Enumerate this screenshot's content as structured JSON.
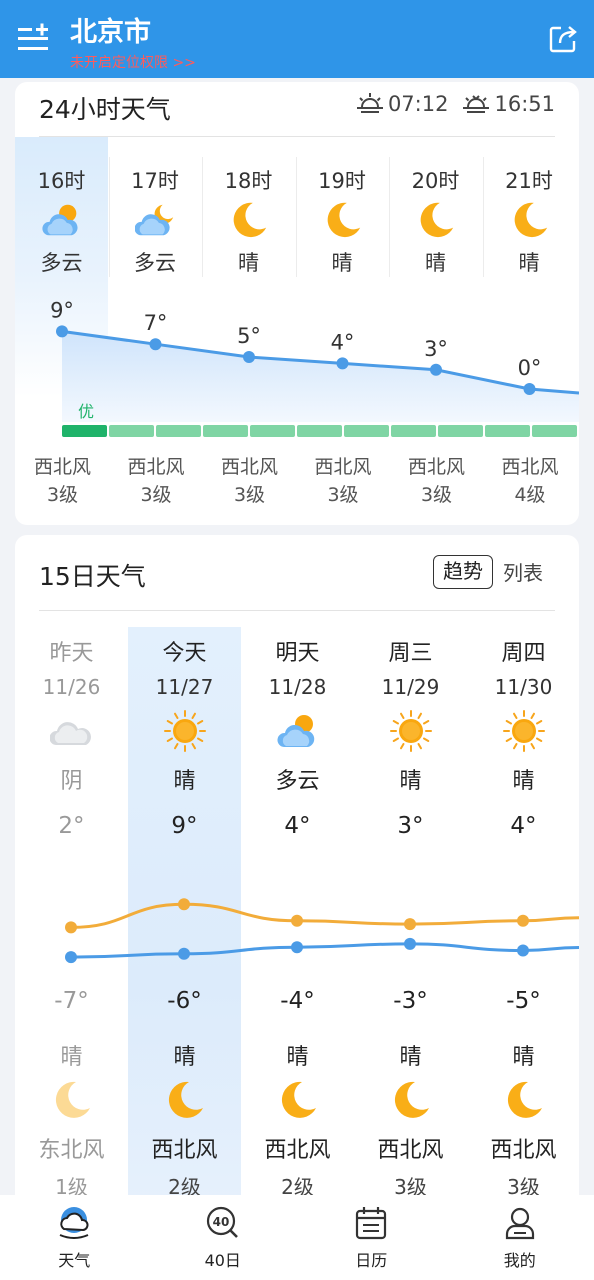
{
  "header": {
    "city": "北京市",
    "location_tip": "未开启定位权限 >>"
  },
  "hourly": {
    "title": "24小时天气",
    "sunrise": "07:12",
    "sunset": "16:51",
    "hours": [
      {
        "time": "16时",
        "weather": "多云",
        "icon": "partly-cloudy-sun-icon",
        "temp": "9°",
        "wind": "西北风",
        "level": "3级"
      },
      {
        "time": "17时",
        "weather": "多云",
        "icon": "partly-cloudy-moon-icon",
        "temp": "7°",
        "wind": "西北风",
        "level": "3级"
      },
      {
        "time": "18时",
        "weather": "晴",
        "icon": "moon-icon",
        "temp": "5°",
        "wind": "西北风",
        "level": "3级"
      },
      {
        "time": "19时",
        "weather": "晴",
        "icon": "moon-icon",
        "temp": "4°",
        "wind": "西北风",
        "level": "3级"
      },
      {
        "time": "20时",
        "weather": "晴",
        "icon": "moon-icon",
        "temp": "3°",
        "wind": "西北风",
        "level": "3级"
      },
      {
        "time": "21时",
        "weather": "晴",
        "icon": "moon-icon",
        "temp": "0°",
        "wind": "西北风",
        "level": "4级"
      }
    ],
    "temp_values": [
      9,
      7,
      5,
      4,
      3,
      0
    ],
    "aqi_label": "优",
    "aqi_color": "#1fb36a",
    "aqi_bar_color": "#7fd5a4"
  },
  "daily": {
    "title": "15日天气",
    "trend_label": "趋势",
    "list_label": "列表",
    "days": [
      {
        "name": "昨天",
        "date": "11/26",
        "weather": "阴",
        "icon": "cloudy-icon",
        "high": "2°",
        "low": "-7°",
        "night_weather": "晴",
        "night_icon": "moon-icon",
        "wind": "东北风",
        "level": "1级",
        "past": true
      },
      {
        "name": "今天",
        "date": "11/27",
        "weather": "晴",
        "icon": "sun-icon",
        "high": "9°",
        "low": "-6°",
        "night_weather": "晴",
        "night_icon": "moon-icon",
        "wind": "西北风",
        "level": "2级",
        "past": false
      },
      {
        "name": "明天",
        "date": "11/28",
        "weather": "多云",
        "icon": "partly-cloudy-sun-icon",
        "high": "4°",
        "low": "-4°",
        "night_weather": "晴",
        "night_icon": "moon-icon",
        "wind": "西北风",
        "level": "2级",
        "past": false
      },
      {
        "name": "周三",
        "date": "11/29",
        "weather": "晴",
        "icon": "sun-icon",
        "high": "3°",
        "low": "-3°",
        "night_weather": "晴",
        "night_icon": "moon-icon",
        "wind": "西北风",
        "level": "3级",
        "past": false
      },
      {
        "name": "周四",
        "date": "11/30",
        "weather": "晴",
        "icon": "sun-icon",
        "high": "4°",
        "low": "-5°",
        "night_weather": "晴",
        "night_icon": "moon-icon",
        "wind": "西北风",
        "level": "3级",
        "past": false
      }
    ],
    "high_values": [
      2,
      9,
      4,
      3,
      4
    ],
    "low_values": [
      -7,
      -6,
      -4,
      -3,
      -5
    ],
    "high_color": "#f2ac3a",
    "low_color": "#4b9be6"
  },
  "nav": {
    "items": [
      {
        "label": "天气",
        "icon": "weather-cloud-icon"
      },
      {
        "label": "40日",
        "icon": "forty-day-icon"
      },
      {
        "label": "日历",
        "icon": "calendar-icon"
      },
      {
        "label": "我的",
        "icon": "profile-icon"
      }
    ]
  },
  "colors": {
    "header_bg": "#2f95e8",
    "accent": "#3d8fe0"
  }
}
